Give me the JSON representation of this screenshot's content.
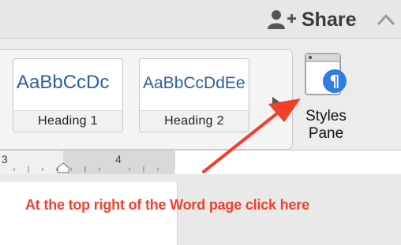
{
  "topbar": {
    "share_label": "Share",
    "share_icon": "add-person-icon",
    "collapse_icon": "chevron-up-icon"
  },
  "ribbon": {
    "styles": [
      {
        "sample": "AaBbCcDc",
        "name": "Heading 1"
      },
      {
        "sample": "AaBbCcDdEe",
        "name": "Heading 2"
      }
    ],
    "gallery_arrow_icon": "triangle-right-icon",
    "styles_pane": {
      "label_line1": "Styles",
      "label_line2": "Pane",
      "icon": "pilcrow-window-icon"
    }
  },
  "ruler": {
    "numbers": [
      "3",
      "4"
    ]
  },
  "annotation": {
    "text": "At the top right of the Word page click here",
    "color": "#f0402c"
  },
  "colors": {
    "style_sample": "#2f5d9a",
    "pilcrow_badge": "#2d7ee0"
  }
}
